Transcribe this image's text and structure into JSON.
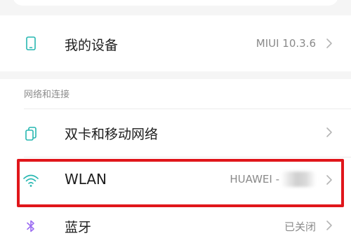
{
  "colors": {
    "accent_icon": "#27b7b1",
    "bluetooth_icon": "#9b6cf2",
    "highlight_border": "#e0161b",
    "muted_text": "#8a8a8a"
  },
  "device_row": {
    "label": "我的设备",
    "value": "MIUI 10.3.6",
    "icon": "phone-icon"
  },
  "section": {
    "title": "网络和连接"
  },
  "network_rows": [
    {
      "label": "双卡和移动网络",
      "value": "",
      "icon": "sim-cards-icon"
    },
    {
      "label": "WLAN",
      "value": "HUAWEI -",
      "icon": "wifi-icon"
    },
    {
      "label": "蓝牙",
      "value": "已关闭",
      "icon": "bluetooth-icon"
    }
  ]
}
